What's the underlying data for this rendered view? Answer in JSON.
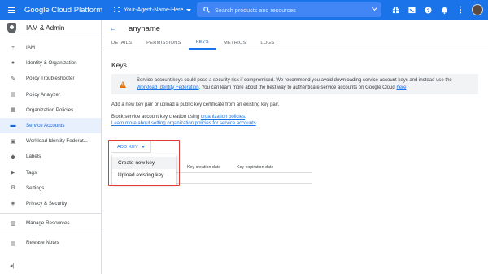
{
  "header": {
    "brand": "Google Cloud Platform",
    "project": "Your-Agent-Name-Here",
    "search_placeholder": "Search products and resources",
    "icons": [
      "gift-icon",
      "terminal-icon",
      "help-icon",
      "bell-icon",
      "more-vert-icon"
    ],
    "colors": {
      "bar": "#1a73e8",
      "search": "#4285f4"
    }
  },
  "sidebar": {
    "title": "IAM & Admin",
    "items": [
      {
        "label": "IAM",
        "icon": "person-add-icon"
      },
      {
        "label": "Identity & Organization",
        "icon": "person-circle-icon"
      },
      {
        "label": "Policy Troubleshooter",
        "icon": "wrench-icon"
      },
      {
        "label": "Policy Analyzer",
        "icon": "document-search-icon"
      },
      {
        "label": "Organization Policies",
        "icon": "list-icon"
      },
      {
        "label": "Service Accounts",
        "icon": "service-account-icon",
        "active": true
      },
      {
        "label": "Workload Identity Federat...",
        "icon": "federation-icon"
      },
      {
        "label": "Labels",
        "icon": "label-icon"
      },
      {
        "label": "Tags",
        "icon": "tag-icon"
      },
      {
        "label": "Settings",
        "icon": "gear-icon"
      },
      {
        "label": "Privacy & Security",
        "icon": "shield-lock-icon"
      },
      {
        "label": "Manage Resources",
        "icon": "resources-icon"
      },
      {
        "label": "Release Notes",
        "icon": "notes-icon"
      }
    ],
    "collapse_icon": "collapse-icon"
  },
  "main": {
    "title": "anyname",
    "tabs": [
      "DETAILS",
      "PERMISSIONS",
      "KEYS",
      "METRICS",
      "LOGS"
    ],
    "active_tab": "KEYS",
    "section_title": "Keys",
    "warning": {
      "text_1": "Service account keys could pose a security risk if compromised. We recommend you avoid downloading service account keys and instead use the",
      "link_1": "Workload Identity Federation",
      "text_2": ". You can learn more about the best way to authenticate service accounts on Google Cloud",
      "link_2": "here",
      "text_3": "."
    },
    "add_text": "Add a new key pair or upload a public key certificate from an existing key pair.",
    "block_text": "Block service account key creation using",
    "block_link": "organization policies",
    "block_end": ".",
    "learn_link": "Learn more about setting organization policies for service accounts",
    "add_key_label": "ADD KEY",
    "table_headers": [
      "Key creation date",
      "Key expiration date"
    ],
    "dropdown": [
      "Create new key",
      "Upload existing key"
    ],
    "colors": {
      "highlight": "#e53935",
      "accent": "#1a73e8",
      "warning": "#e37400"
    }
  }
}
